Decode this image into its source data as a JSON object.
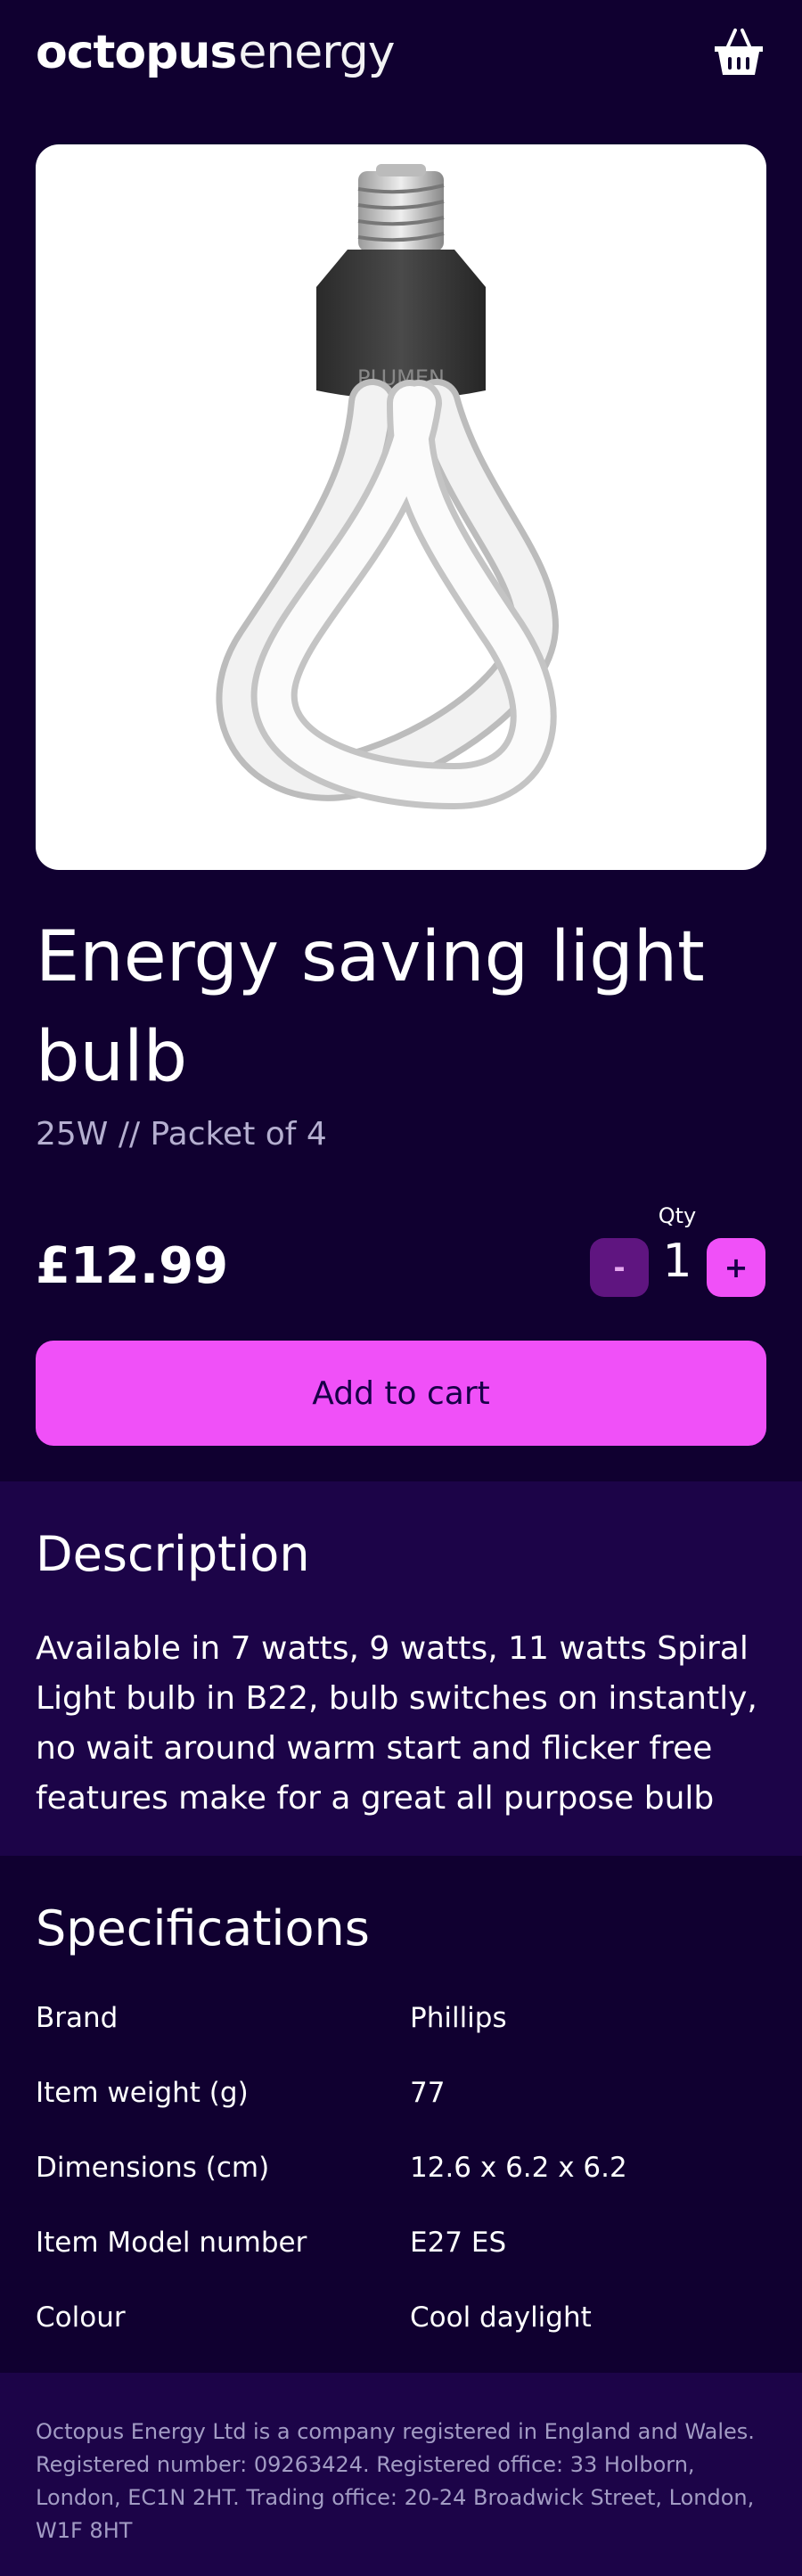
{
  "header": {
    "logo_bold": "octopus",
    "logo_light": "energy",
    "basket_icon": "basket-icon"
  },
  "product": {
    "image_icon": "light-bulb-image",
    "image_brand_mark": "PLUMEN",
    "title": "Energy saving light bulb",
    "subtitle": "25W // Packet of 4",
    "price": "£12.99"
  },
  "quantity": {
    "label": "Qty",
    "value": "1",
    "minus_label": "-",
    "plus_label": "+"
  },
  "cart": {
    "add_label": "Add to cart"
  },
  "description": {
    "title": "Description",
    "text": "Available in 7 watts, 9 watts, 11 watts Spiral Light bulb in B22, bulb switches on instantly, no wait around warm start and flicker free features make for a great all purpose bulb"
  },
  "specifications": {
    "title": "Specifications",
    "rows": [
      {
        "key": "Brand",
        "value": "Phillips"
      },
      {
        "key": "Item weight (g)",
        "value": "77"
      },
      {
        "key": "Dimensions (cm)",
        "value": "12.6 x 6.2 x 6.2"
      },
      {
        "key": "Item Model number",
        "value": "E27 ES"
      },
      {
        "key": "Colour",
        "value": "Cool daylight"
      }
    ]
  },
  "footer": {
    "text": "Octopus Energy Ltd is a company registered in England and Wales. Registered number: 09263424. Registered office: 33 Holborn, London, EC1N 2HT. Trading office: 20-24 Broadwick Street, London, W1F 8HT"
  },
  "colors": {
    "background": "#100030",
    "section": "#1c0448",
    "accent": "#f050f8",
    "minus_button": "#5f1580",
    "muted_text": "#b5afd0"
  }
}
